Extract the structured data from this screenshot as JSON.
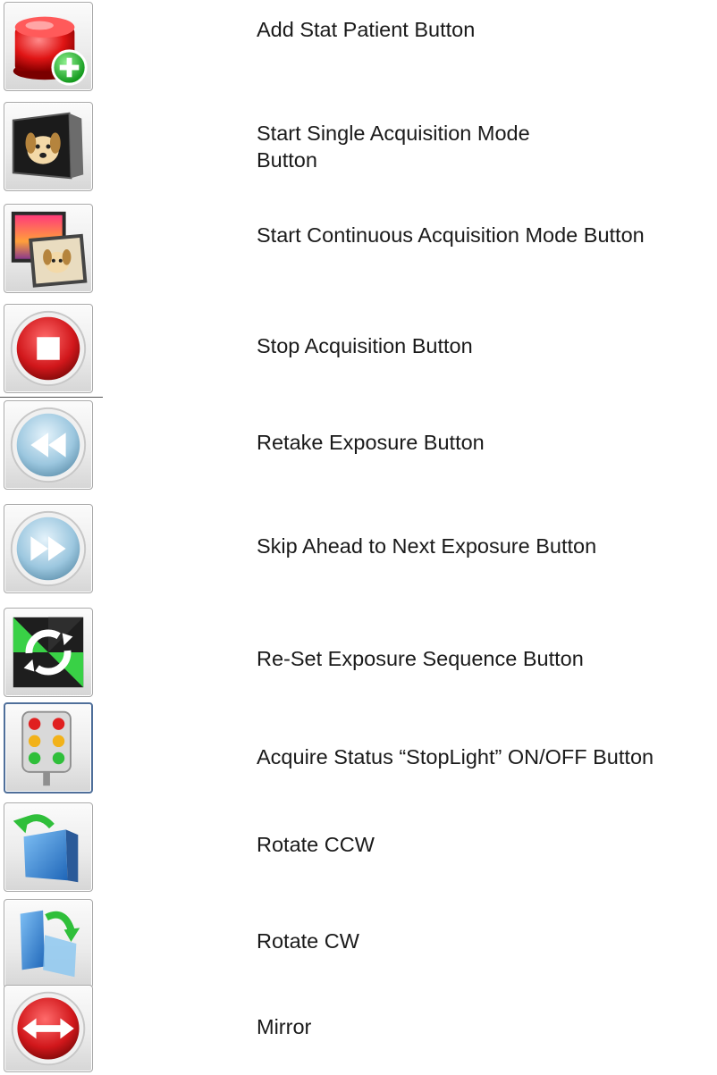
{
  "items": [
    {
      "icon": "stat-siren-add-icon",
      "label": "Add Stat Patient Button"
    },
    {
      "icon": "single-acquisition-icon",
      "label": "Start Single Acquisition Mode Button"
    },
    {
      "icon": "continuous-acquisition-icon",
      "label": "Start Continuous Acquisition Mode Button"
    },
    {
      "icon": "stop-icon",
      "label": "Stop Acquisition Button"
    },
    {
      "icon": "rewind-icon",
      "label": "Retake Exposure Button"
    },
    {
      "icon": "fast-forward-icon",
      "label": "Skip Ahead to Next Exposure Button"
    },
    {
      "icon": "reset-sequence-icon",
      "label": "Re-Set Exposure Sequence Button"
    },
    {
      "icon": "stoplight-icon",
      "label": "Acquire Status “StopLight” ON/OFF Button"
    },
    {
      "icon": "rotate-ccw-icon",
      "label": "Rotate CCW"
    },
    {
      "icon": "rotate-cw-icon",
      "label": "Rotate CW"
    },
    {
      "icon": "mirror-icon",
      "label": "Mirror"
    }
  ],
  "colors": {
    "red": "#d1171b",
    "green": "#2fbf3a",
    "blue": "#2f7fd0",
    "steel": "#9cc7df"
  }
}
